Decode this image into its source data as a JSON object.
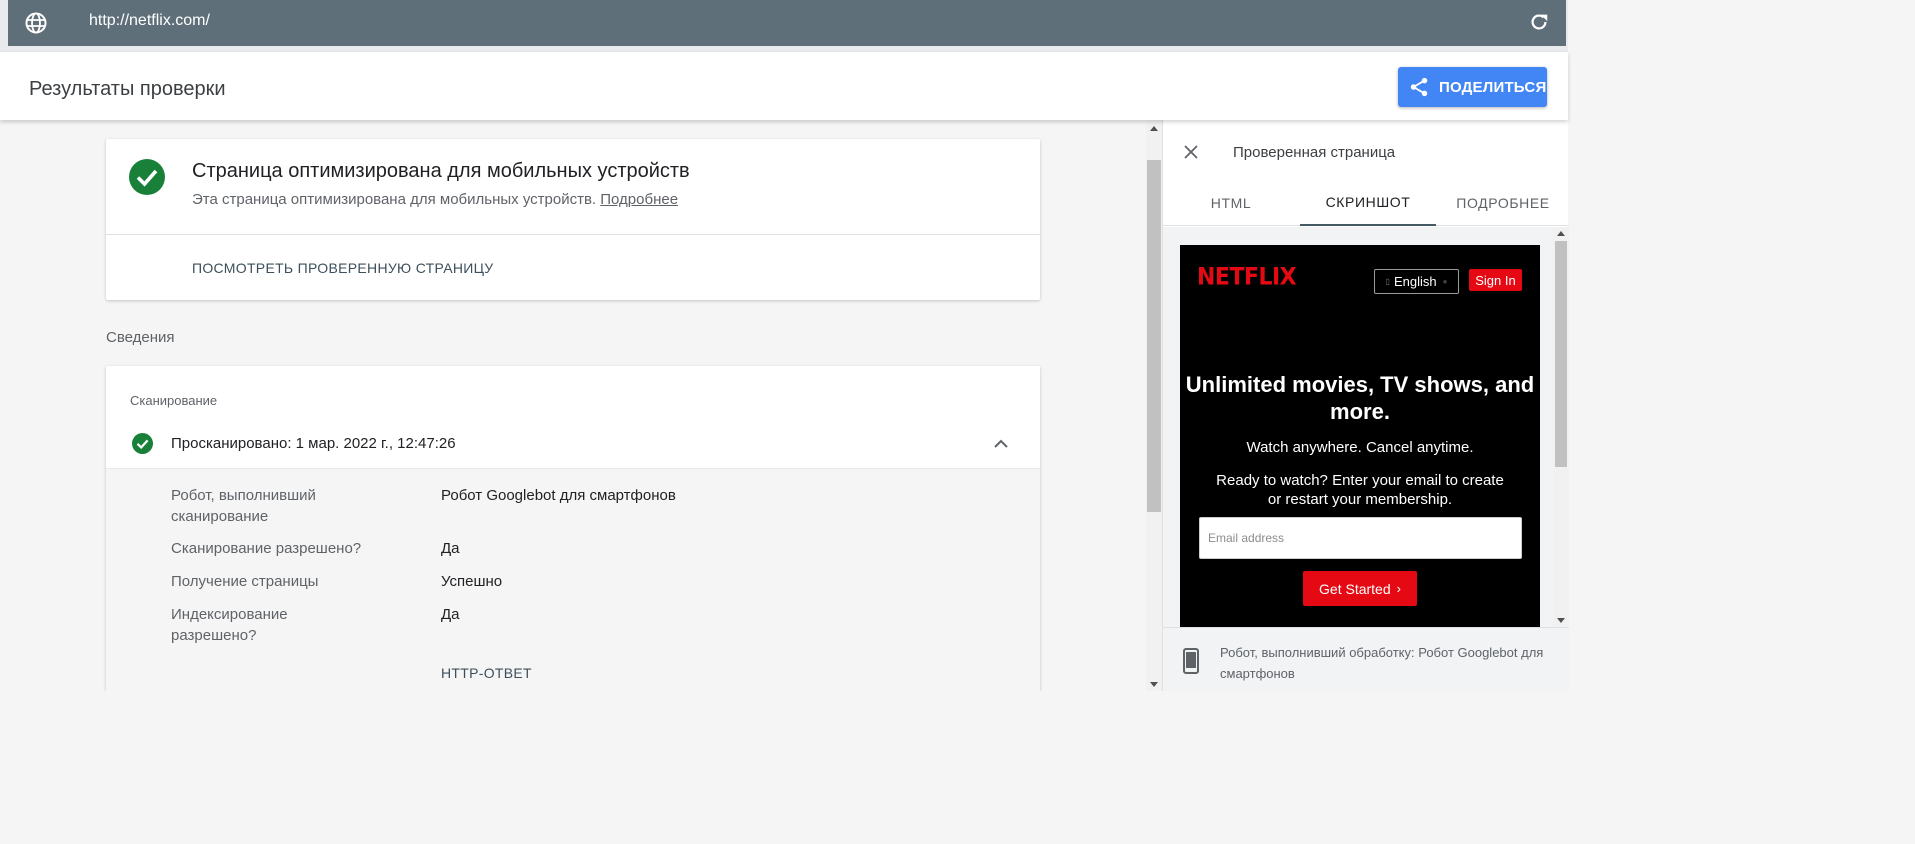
{
  "url_bar": {
    "url": "http://netflix.com/"
  },
  "header": {
    "title": "Результаты проверки",
    "share_label": "ПОДЕЛИТЬСЯ"
  },
  "result_card": {
    "title": "Страница оптимизирована для мобильных устройств",
    "description": "Эта страница оптимизирована для мобильных устройств.",
    "more_link": "Подробнее",
    "view_tested_page": "ПОСМОТРЕТЬ ПРОВЕРЕННУЮ СТРАНИЦУ"
  },
  "details_section": {
    "label": "Сведения",
    "crawl_card": {
      "subtitle": "Сканирование",
      "status": "Просканировано: 1 мар. 2022 г., 12:47:26",
      "rows": [
        {
          "label": "Робот, выполнивший сканирование",
          "value": "Робот Googlebot для смартфонов"
        },
        {
          "label": "Сканирование разрешено?",
          "value": "Да"
        },
        {
          "label": "Получение страницы",
          "value": "Успешно"
        },
        {
          "label": "Индексирование разрешено?",
          "value": "Да"
        }
      ],
      "http_response_label": "HTTP-ОТВЕТ"
    }
  },
  "panel": {
    "title": "Проверенная страница",
    "tabs": [
      "HTML",
      "СКРИНШОТ",
      "ПОДРОБНЕЕ"
    ],
    "active_tab": "СКРИНШОТ",
    "footer": "Робот, выполнивший обработку: Робот Googlebot для смартфонов"
  },
  "netflix_screenshot": {
    "logo": "NETFLIX",
    "language": "English",
    "sign_in": "Sign In",
    "headline": "Unlimited movies, TV shows, and more.",
    "subheadline": "Watch anywhere. Cancel anytime.",
    "prompt": "Ready to watch? Enter your email to create or restart your membership.",
    "email_placeholder": "Email address",
    "cta": "Get Started",
    "cta_chevron": "›"
  },
  "colors": {
    "url_bar": "#5f6f7a",
    "share_button": "#4285f4",
    "success_green": "#188038",
    "netflix_red": "#e50914"
  },
  "icons": [
    "globe-icon",
    "reload-icon",
    "share-icon",
    "check-circle-icon",
    "chevron-up-icon",
    "close-icon",
    "phone-icon"
  ]
}
